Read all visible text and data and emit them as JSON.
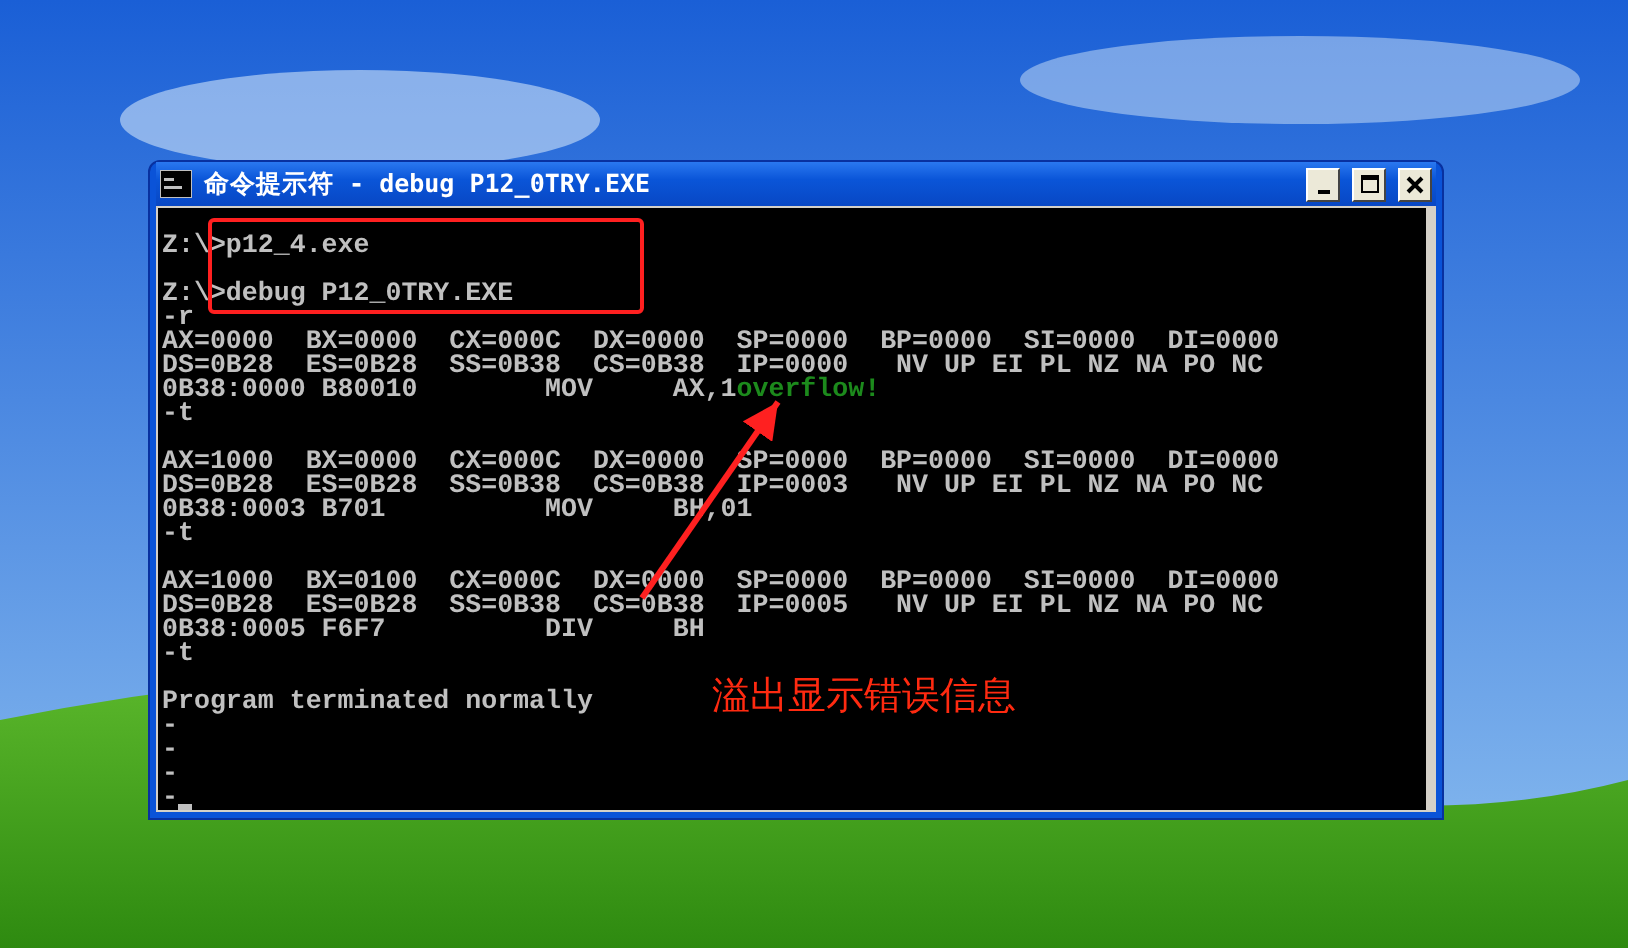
{
  "window": {
    "title": "命令提示符 - debug P12_0TRY.EXE"
  },
  "console": {
    "lines": [
      {
        "text": "Z:\\>p12_4.exe",
        "blank_before": false
      },
      {
        "text": "Z:\\>debug P12_0TRY.EXE",
        "blank_before": true
      },
      {
        "text": "-r",
        "blank_before": false
      },
      {
        "text": "AX=0000  BX=0000  CX=000C  DX=0000  SP=0000  BP=0000  SI=0000  DI=0000",
        "blank_before": false
      },
      {
        "text": "DS=0B28  ES=0B28  SS=0B38  CS=0B38  IP=0000   NV UP EI PL NZ NA PO NC",
        "blank_before": false
      },
      {
        "text": "0B38:0000 B80010        MOV     AX,1",
        "message": "overflow!",
        "blank_before": false
      },
      {
        "text": "-t",
        "blank_before": false
      },
      {
        "text": "AX=1000  BX=0000  CX=000C  DX=0000  SP=0000  BP=0000  SI=0000  DI=0000",
        "blank_before": true
      },
      {
        "text": "DS=0B28  ES=0B28  SS=0B38  CS=0B38  IP=0003   NV UP EI PL NZ NA PO NC",
        "blank_before": false
      },
      {
        "text": "0B38:0003 B701          MOV     BH,01",
        "blank_before": false
      },
      {
        "text": "-t",
        "blank_before": false
      },
      {
        "text": "AX=1000  BX=0100  CX=000C  DX=0000  SP=0000  BP=0000  SI=0000  DI=0000",
        "blank_before": true
      },
      {
        "text": "DS=0B28  ES=0B28  SS=0B38  CS=0B38  IP=0005   NV UP EI PL NZ NA PO NC",
        "blank_before": false
      },
      {
        "text": "0B38:0005 F6F7          DIV     BH",
        "blank_before": false
      },
      {
        "text": "-t",
        "blank_before": false
      },
      {
        "text": "Program terminated normally",
        "blank_before": true
      },
      {
        "text": "-",
        "blank_before": false
      },
      {
        "text": "-",
        "blank_before": false
      },
      {
        "text": "-",
        "blank_before": false
      },
      {
        "text": "-",
        "blank_before": false,
        "cursor": true
      }
    ]
  },
  "annotation": {
    "text": "溢出显示错误信息"
  }
}
